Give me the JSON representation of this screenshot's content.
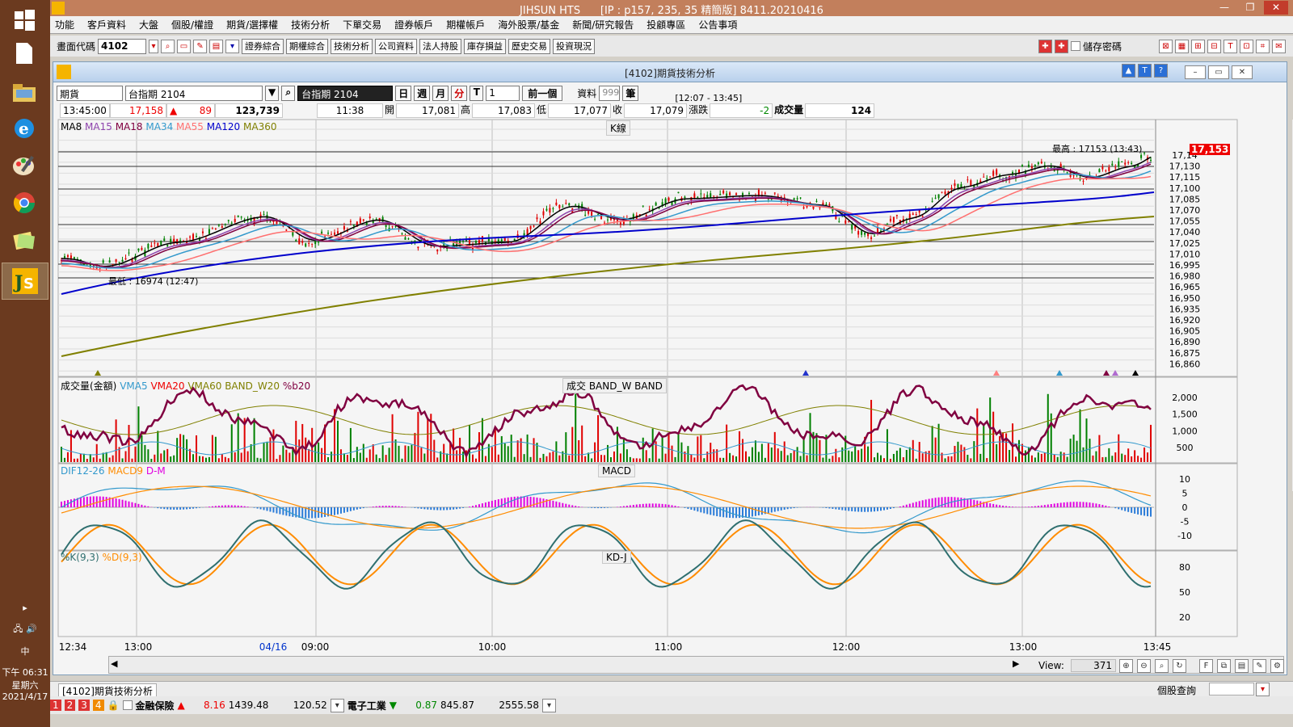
{
  "window": {
    "title": "JIHSUN HTS",
    "title_ip": "[IP : p157, 235, 35 精簡版] 8411.20210416"
  },
  "menu": [
    "功能",
    "客戶資料",
    "大盤",
    "個股/權證",
    "期貨/選擇權",
    "技術分析",
    "下單交易",
    "證券帳戶",
    "期權帳戶",
    "海外股票/基金",
    "新聞/研究報告",
    "投顧專區",
    "公告事項"
  ],
  "toolbar": {
    "code_label": "畫面代碼",
    "code_value": "4102",
    "buttons": [
      "證券綜合",
      "期權綜合",
      "技術分析",
      "公司資料",
      "法人持股",
      "庫存損益",
      "歷史交易",
      "投資現況"
    ],
    "save_password": "儲存密碼"
  },
  "panel": {
    "title": "[4102]期貨技術分析",
    "type_select": "期貨",
    "symbol_select": "台指期 2104",
    "symbol_display": "台指期 2104",
    "periods": [
      "日",
      "週",
      "月",
      "分",
      "T"
    ],
    "interval": "1",
    "prev_button": "前一個",
    "data_label": "資料",
    "data_count": "999",
    "unit": "筆",
    "range": "[12:07 - 13:45]"
  },
  "quote": {
    "time": "13:45:00",
    "price": "17,158",
    "change": "89",
    "volume_total": "123,739",
    "last_time": "11:38",
    "open_label": "開",
    "open": "17,081",
    "high_label": "高",
    "high": "17,083",
    "low_label": "低",
    "low": "17,077",
    "close_label": "收",
    "close": "17,079",
    "chg_label": "漲跌",
    "chg": "-2",
    "vol_label": "成交量",
    "vol": "124"
  },
  "kline": {
    "legend": [
      "MA8",
      "MA15",
      "MA18",
      "MA34",
      "MA55",
      "MA120",
      "MA360"
    ],
    "legend_colors": [
      "#000000",
      "#8e44ad",
      "#800040",
      "#3399cc",
      "#ff7070",
      "#0000cc",
      "#808000"
    ],
    "title": "K線",
    "high_note": "最高 : 17153 (13:43)",
    "low_note": "最低 : 16974 (12:47)",
    "price_tag": "17,153",
    "price_ticks": [
      "17,14",
      "17,130",
      "17,115",
      "17,100",
      "17,085",
      "17,070",
      "17,055",
      "17,040",
      "17,025",
      "17,010",
      "16,995",
      "16,980",
      "16,965",
      "16,950",
      "16,935",
      "16,920",
      "16,905",
      "16,890",
      "16,875",
      "16,860"
    ]
  },
  "volume": {
    "legend": "成交量(金額)",
    "legend_items": [
      "VMA5",
      "VMA20",
      "VMA60",
      "BAND_W20",
      "%b20"
    ],
    "title": "成交  BAND_W  BAND",
    "ticks": [
      "2,000",
      "1,500",
      "1,000",
      "500"
    ]
  },
  "macd": {
    "legend": [
      "DIF12-26",
      "MACD9",
      "D-M"
    ],
    "title": "MACD",
    "ticks": [
      "10",
      "5",
      "0",
      "-5",
      "-10"
    ]
  },
  "kd": {
    "legend": [
      "%K(9,3)",
      "%D(9,3)"
    ],
    "title": "KD-J",
    "ticks": [
      "80",
      "50",
      "20"
    ]
  },
  "time_axis": [
    "12:34",
    "13:00",
    "04/16",
    "09:00",
    "10:00",
    "11:00",
    "12:00",
    "13:00",
    "13:45"
  ],
  "view_label": "View:",
  "view_value": "371",
  "statusbar": {
    "tab": "[4102]期貨技術分析",
    "right": "個股查詢"
  },
  "ticker": [
    {
      "name": "金融保險",
      "dir": "up",
      "change": "8.16",
      "index": "1439.48",
      "volume": "120.52"
    },
    {
      "name": "電子工業",
      "dir": "down",
      "change": "0.87",
      "index": "845.87",
      "volume": "2555.58"
    }
  ],
  "clock": {
    "time": "下午 06:31",
    "weekday": "星期六",
    "date": "2021/4/17",
    "ime": "中"
  }
}
